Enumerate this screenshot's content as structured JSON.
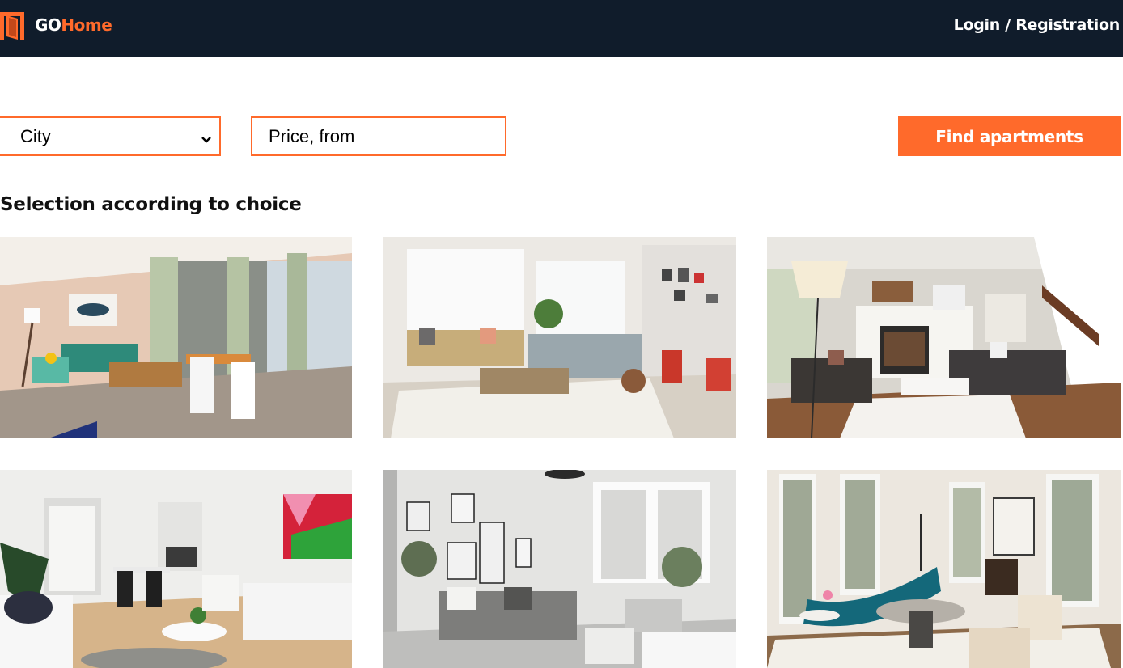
{
  "header": {
    "logo_part1": "GO",
    "logo_part2": "Home",
    "login_label": "Login / Registration"
  },
  "search": {
    "city_value": "City",
    "price_placeholder": "Price, from",
    "find_label": "Find apartments"
  },
  "section": {
    "title": "Selection according to choice"
  },
  "colors": {
    "header_bg": "#101c2b",
    "accent": "#ff6a2b"
  },
  "listings": [
    {
      "name": "apartment-photo-1"
    },
    {
      "name": "apartment-photo-2"
    },
    {
      "name": "apartment-photo-3"
    },
    {
      "name": "apartment-photo-4"
    },
    {
      "name": "apartment-photo-5"
    },
    {
      "name": "apartment-photo-6"
    }
  ]
}
